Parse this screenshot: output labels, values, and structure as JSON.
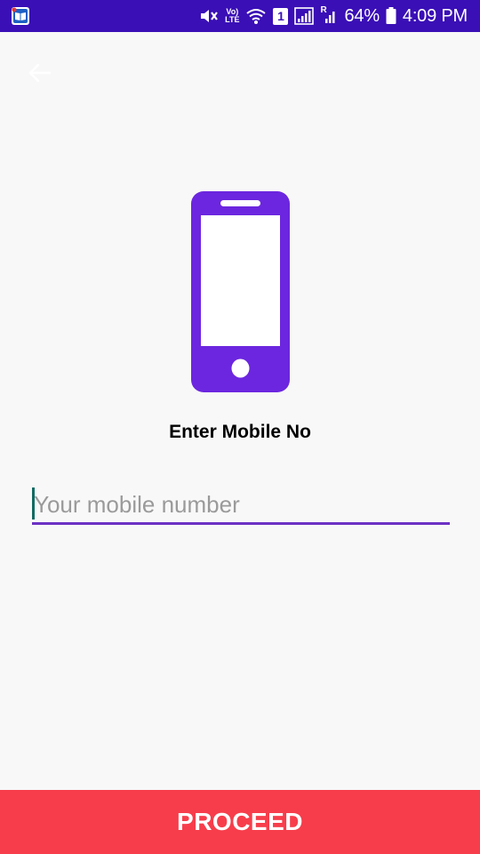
{
  "status_bar": {
    "volte_label_top": "Vo)",
    "volte_label_bottom": "LTE",
    "sim_slot": "1",
    "roaming_indicator": "R",
    "battery_percent": "64%",
    "time": "4:09 PM",
    "icons": [
      "app-notification-icon",
      "mute-icon",
      "volte-icon",
      "wifi-icon",
      "sim-icon",
      "signal-icon",
      "signal-roaming-icon",
      "battery-icon"
    ]
  },
  "header": {
    "back_icon": "arrow-left-icon"
  },
  "main": {
    "illustration_icon": "smartphone-icon",
    "title": "Enter Mobile No",
    "mobile_input": {
      "placeholder": "Your mobile number",
      "value": ""
    }
  },
  "footer": {
    "proceed_label": "PROCEED"
  },
  "colors": {
    "status_bar": "#3a0fb6",
    "accent_purple": "#6c31c4",
    "phone_purple": "#6c26df",
    "proceed_red": "#f73d4b",
    "background": "#f8f8f8"
  }
}
